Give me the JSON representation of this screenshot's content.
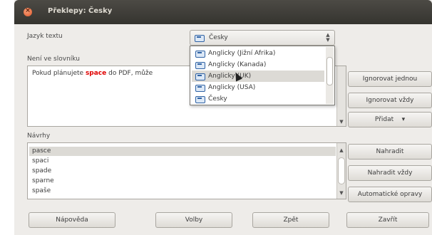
{
  "window": {
    "title": "Překlepy: Česky"
  },
  "language": {
    "label": "Jazyk textu",
    "selected": "Česky"
  },
  "not_in_dict": {
    "label": "Není ve slovníku",
    "before": "Pokud plánujete ",
    "error_word": "space",
    "after": " do PDF, může"
  },
  "dropdown": {
    "options": [
      "Anglicky (Jižní Afrika)",
      "Anglicky (Kanada)",
      "Anglicky (UK)",
      "Anglicky (USA)",
      "Česky"
    ],
    "highlighted": 2
  },
  "right_buttons": {
    "ignore_once": "Ignorovat jednou",
    "ignore_all": "Ignorovat vždy",
    "add": "Přidat"
  },
  "suggestions": {
    "label": "Návrhy",
    "items": [
      "pasce",
      "spaci",
      "spade",
      "sparne",
      "spaše"
    ],
    "selected": 0
  },
  "suggest_buttons": {
    "replace": "Nahradit",
    "replace_all": "Nahradit vždy",
    "autocorrect": "Automatické opravy"
  },
  "bottom": {
    "help": "Nápověda",
    "options": "Volby",
    "undo": "Zpět",
    "close": "Zavřít"
  }
}
